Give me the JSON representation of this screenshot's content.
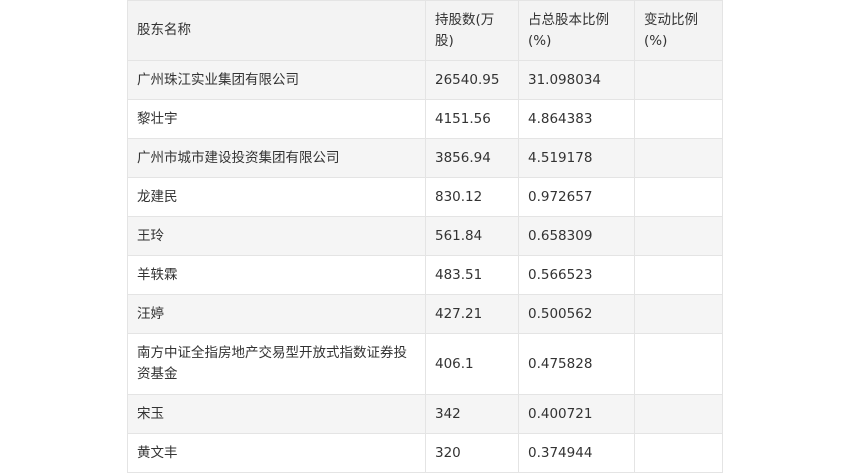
{
  "table": {
    "headers": [
      "股东名称",
      "持股数(万股)",
      "占总股本比例(%)",
      "变动比例(%)"
    ],
    "rows": [
      [
        "广州珠江实业集团有限公司",
        "26540.95",
        "31.098034",
        ""
      ],
      [
        "黎壮宇",
        "4151.56",
        "4.864383",
        ""
      ],
      [
        "广州市城市建设投资集团有限公司",
        "3856.94",
        "4.519178",
        ""
      ],
      [
        "龙建民",
        "830.12",
        "0.972657",
        ""
      ],
      [
        "王玲",
        "561.84",
        "0.658309",
        ""
      ],
      [
        "羊轶霖",
        "483.51",
        "0.566523",
        ""
      ],
      [
        "汪婷",
        "427.21",
        "0.500562",
        ""
      ],
      [
        "南方中证全指房地产交易型开放式指数证券投资基金",
        "406.1",
        "0.475828",
        ""
      ],
      [
        "宋玉",
        "342",
        "0.400721",
        ""
      ],
      [
        "黄文丰",
        "320",
        "0.374944",
        ""
      ]
    ]
  },
  "colors": {
    "header_bg": "#f3f3f3",
    "row_alt_bg": "#f5f5f5",
    "border": "#e4e4e4",
    "text": "#333333"
  }
}
